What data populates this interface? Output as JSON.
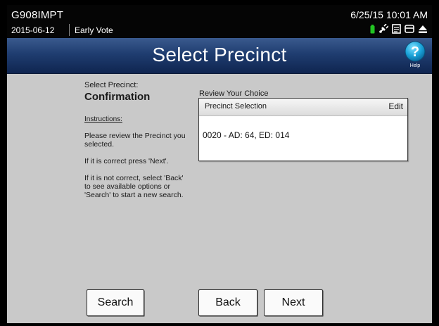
{
  "status_bar": {
    "election_code": "G908IMPT",
    "election_date": "2015-06-12",
    "vote_mode": "Early Vote",
    "datetime": "6/25/15  10:01 AM",
    "icons": [
      "battery-icon",
      "plug-icon",
      "printer-icon",
      "ballot-icon",
      "eject-icon"
    ]
  },
  "title_bar": {
    "title": "Select Precinct",
    "help_label": "Help"
  },
  "left_panel": {
    "step_label": "Select Precinct:",
    "step_heading": "Confirmation",
    "instructions_label": "Instructions:",
    "instructions": [
      "Please review the Precinct you selected.",
      "If it is correct press 'Next'.",
      "If it is not correct, select 'Back' to see available options or 'Search' to start a new search."
    ]
  },
  "review": {
    "label": "Review Your Choice",
    "card_header": "Precinct Selection",
    "edit_label": "Edit",
    "selected_precinct": "0020 - AD: 64, ED: 014"
  },
  "buttons": {
    "search": "Search",
    "back": "Back",
    "next": "Next"
  },
  "colors": {
    "title_bar_top": "#3a5a8e",
    "title_bar_bottom": "#0f2550",
    "content_bg": "#c9c9c9",
    "battery_green": "#22c322"
  }
}
